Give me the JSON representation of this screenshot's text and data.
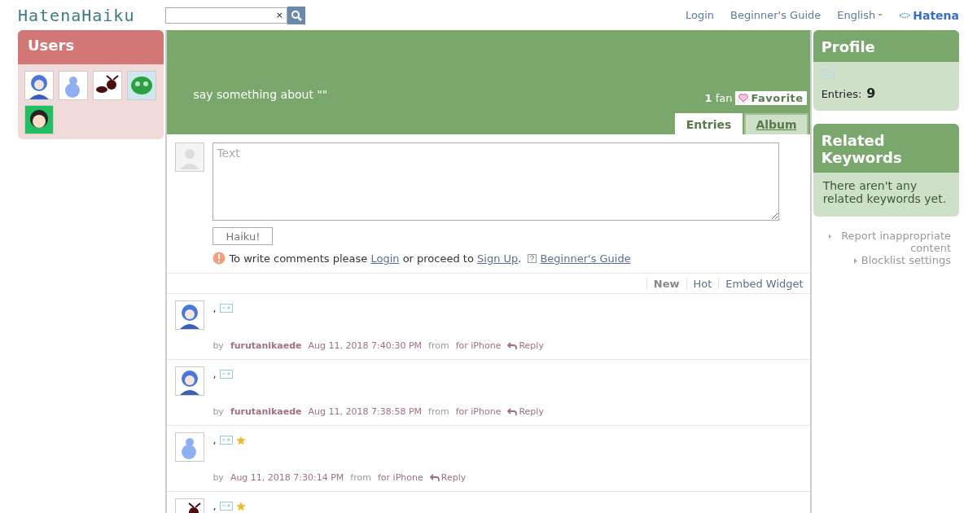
{
  "header": {
    "logo": "HatenaHaiku",
    "search": {
      "clear": "×"
    },
    "links": [
      "Login",
      "Beginner's Guide"
    ],
    "language": "English",
    "brand": "Hatena"
  },
  "users": {
    "title": "Users",
    "avatars": [
      {
        "kind": "figure-blue"
      },
      {
        "kind": "gourd"
      },
      {
        "kind": "ant"
      },
      {
        "kind": "blob"
      },
      {
        "kind": "figure-dark"
      }
    ]
  },
  "keyword": {
    "prompt": "say something about \"\"",
    "fans": "1",
    "fans_label": "fan",
    "favorite": "Favorite",
    "tabs": [
      {
        "label": "Entries",
        "selected": true
      },
      {
        "label": "Album",
        "selected": false
      }
    ]
  },
  "compose": {
    "placeholder": "Text",
    "submit": "Haiku!",
    "notice_parts": [
      "To write comments please ",
      "Login",
      " or proceed to ",
      "Sign Up",
      "."
    ],
    "guide": "Beginner's Guide"
  },
  "sort_tabs": [
    {
      "label": "New",
      "selected": true
    },
    {
      "label": "Hot",
      "selected": false
    },
    {
      "label": "Embed Widget",
      "selected": false
    }
  ],
  "entries": [
    {
      "kind": "figure-blue",
      "text": ",",
      "starred": false,
      "by": "by",
      "author": "furutanikaede",
      "time": "Aug 11, 2018 7:40:30 PM",
      "from": "from",
      "source": "for iPhone",
      "reply": "Reply"
    },
    {
      "kind": "figure-blue",
      "text": ",",
      "starred": false,
      "by": "by",
      "author": "furutanikaede",
      "time": "Aug 11, 2018 7:38:58 PM",
      "from": "from",
      "source": "for iPhone",
      "reply": "Reply"
    },
    {
      "kind": "gourd",
      "text": ",",
      "starred": true,
      "by": "by",
      "time": "Aug 11, 2018 7:30:14 PM",
      "from": "from",
      "source": "for iPhone",
      "reply": "Reply"
    },
    {
      "kind": "ant",
      "text": ",",
      "starred": true
    }
  ],
  "profile": {
    "title": "Profile",
    "entries_label": "Entries:",
    "entries": "9"
  },
  "related": {
    "title": "Related Keywords",
    "body": "There aren't any related keywords yet."
  },
  "side_links": [
    "Report inappropriate content",
    "Blocklist settings"
  ]
}
